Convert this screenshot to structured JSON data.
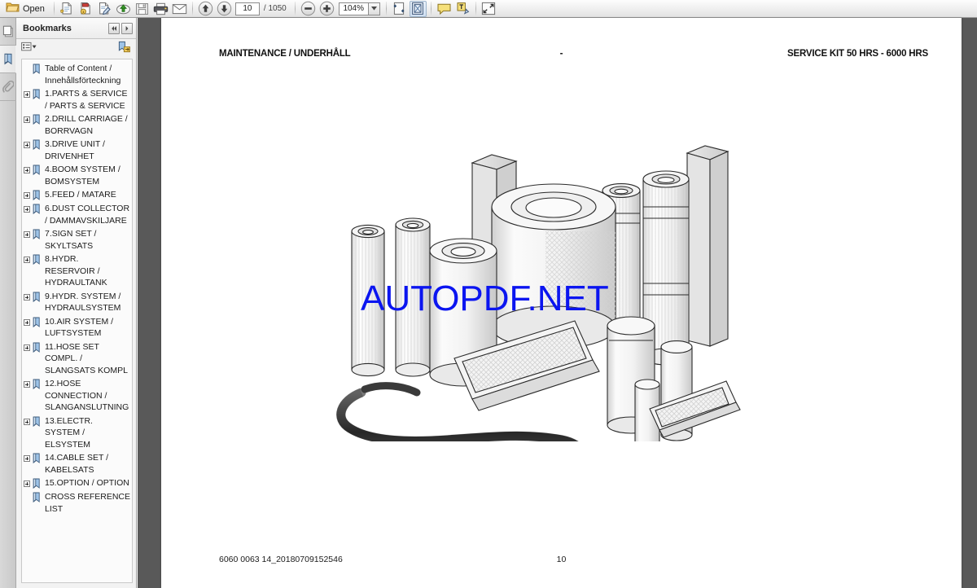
{
  "toolbar": {
    "open_label": "Open",
    "open_icon": "folder-open-icon",
    "buttons": [
      {
        "name": "save-a-copy-icon",
        "label": "Save a Copy"
      },
      {
        "name": "secure-document-icon",
        "label": "Secure"
      },
      {
        "name": "sign-document-icon",
        "label": "Sign"
      },
      {
        "name": "upload-document-icon",
        "label": "Upload"
      },
      {
        "name": "save-icon",
        "label": "Save"
      },
      {
        "name": "print-icon",
        "label": "Print"
      },
      {
        "name": "email-icon",
        "label": "Email"
      }
    ],
    "previous_page_icon": "arrow-up-icon",
    "next_page_icon": "arrow-down-icon",
    "current_page": "10",
    "page_total": "/ 1050",
    "zoom_out_icon": "minus-circle-icon",
    "zoom_in_icon": "plus-circle-icon",
    "zoom_value": "104%",
    "zoom_dropdown_icon": "chevron-down-icon",
    "fit_width_icon": "fit-width-icon",
    "fit_page_icon": "fit-page-icon",
    "comment_icon": "comment-bubble-icon",
    "typewriter_icon": "typewriter-icon",
    "fullscreen_icon": "fullscreen-icon"
  },
  "rail": {
    "tabs": [
      {
        "name": "pages-thumbnail-tab",
        "icon": "page-thumbnail-icon",
        "active": "false"
      },
      {
        "name": "bookmarks-tab",
        "icon": "bookmark-icon",
        "active": "true"
      },
      {
        "name": "attachments-tab",
        "icon": "paperclip-icon",
        "active": "false"
      }
    ]
  },
  "panel": {
    "title": "Bookmarks",
    "collapse_left_icon": "double-chevron-left-icon",
    "collapse_right_icon": "chevron-right-icon",
    "options_icon": "list-options-icon",
    "expand_bookmarks_icon": "expand-bookmark-icon",
    "bookmarks": [
      {
        "label": "Table of Content / Innehållsförteckning",
        "expandable": "false"
      },
      {
        "label": "1.PARTS & SERVICE / PARTS & SERVICE",
        "expandable": "true"
      },
      {
        "label": "2.DRILL CARRIAGE / BORRVAGN",
        "expandable": "true"
      },
      {
        "label": "3.DRIVE UNIT / DRIVENHET",
        "expandable": "true"
      },
      {
        "label": "4.BOOM SYSTEM / BOMSYSTEM",
        "expandable": "true"
      },
      {
        "label": "5.FEED / MATARE",
        "expandable": "true"
      },
      {
        "label": "6.DUST COLLECTOR / DAMMAVSKILJARE",
        "expandable": "true"
      },
      {
        "label": "7.SIGN SET / SKYLTSATS",
        "expandable": "true"
      },
      {
        "label": "8.HYDR. RESERVOIR / HYDRAULTANK",
        "expandable": "true"
      },
      {
        "label": "9.HYDR. SYSTEM / HYDRAULSYSTEM",
        "expandable": "true"
      },
      {
        "label": "10.AIR SYSTEM / LUFTSYSTEM",
        "expandable": "true"
      },
      {
        "label": "11.HOSE SET COMPL. / SLANGSATS KOMPL",
        "expandable": "true"
      },
      {
        "label": "12.HOSE CONNECTION / SLANGANSLUTNING",
        "expandable": "true"
      },
      {
        "label": "13.ELECTR. SYSTEM / ELSYSTEM",
        "expandable": "true"
      },
      {
        "label": "14.CABLE SET / KABELSATS",
        "expandable": "true"
      },
      {
        "label": "15.OPTION / OPTION",
        "expandable": "true"
      },
      {
        "label": "CROSS REFERENCE LIST",
        "expandable": "false"
      }
    ]
  },
  "document": {
    "header_left": "MAINTENANCE / UNDERHÅLL",
    "header_center": "-",
    "header_right": "SERVICE KIT 50 HRS - 6000 HRS",
    "footer_left": "6060 0063 14_20180709152546",
    "footer_center": "10",
    "watermark": "AUTOPDF.NET",
    "watermark_color": "#0b15f0",
    "illustration_alt": "service kit parts: filter cartridges, canister filters, panel filters and drive belt"
  }
}
